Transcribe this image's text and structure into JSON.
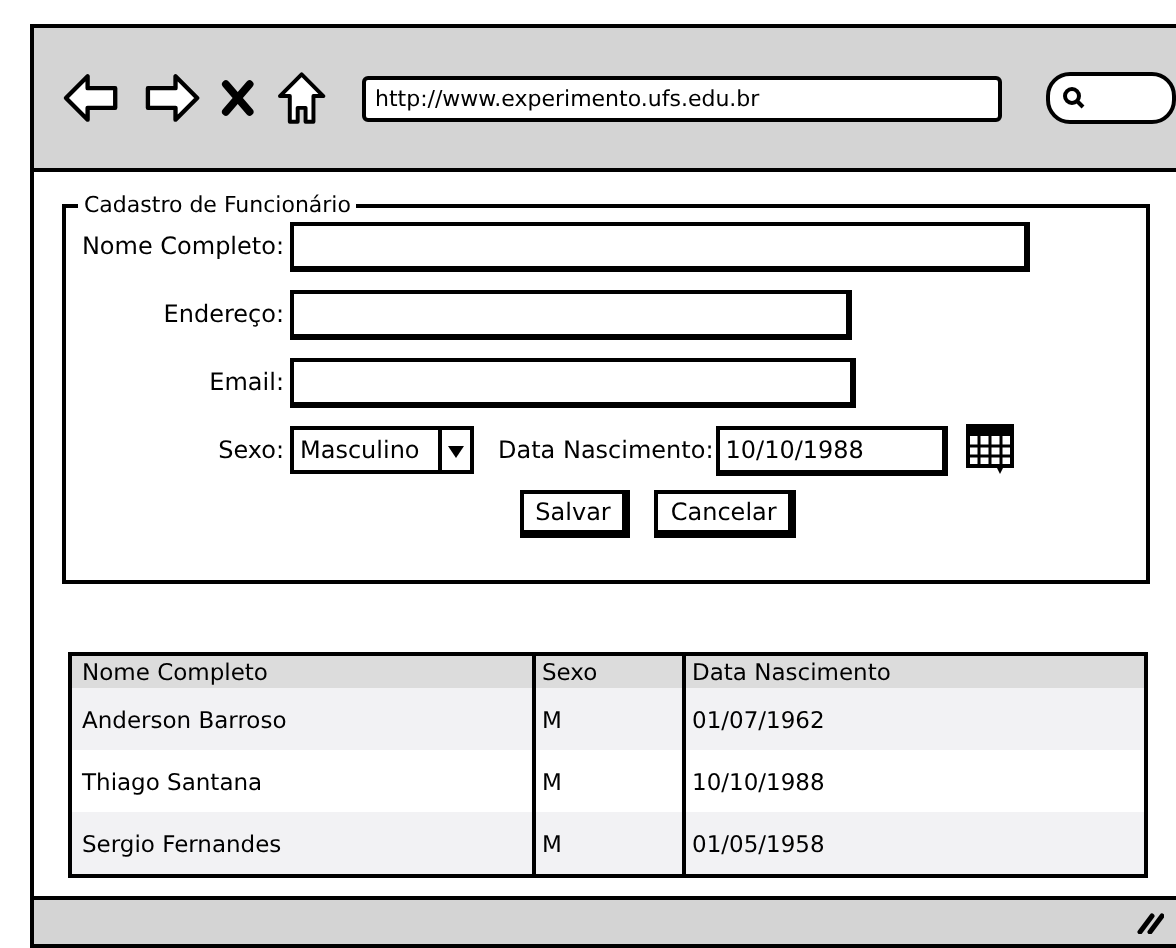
{
  "browser": {
    "url": "http://www.experimento.ufs.edu.br"
  },
  "form": {
    "legend": "Cadastro de Funcionário",
    "fields": [
      {
        "label": "Nome Completo:"
      },
      {
        "label": "Endereço:"
      },
      {
        "label": "Email:"
      }
    ],
    "sex": {
      "label": "Sexo:",
      "value": "Masculino"
    },
    "birth": {
      "label": "Data Nascimento:",
      "value": "10/10/1988"
    },
    "buttons": [
      "Salvar",
      "Cancelar"
    ]
  },
  "table": {
    "columns": [
      "Nome Completo",
      "Sexo",
      "Data Nascimento"
    ],
    "rows": [
      [
        "Anderson Barroso",
        "M",
        "01/07/1962"
      ],
      [
        "Thiago Santana",
        "M",
        "10/10/1988"
      ],
      [
        "Sergio Fernandes",
        "M",
        "01/05/1958"
      ]
    ]
  }
}
